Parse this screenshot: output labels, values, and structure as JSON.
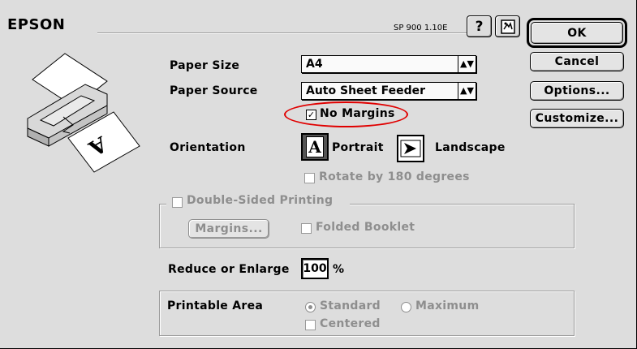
{
  "header": {
    "brand": "EPSON",
    "version": "SP 900 1.10E",
    "help_icon": "?",
    "help_icon_name": "help-icon",
    "utility_icon_name": "printer-utility-icon"
  },
  "buttons": {
    "ok": "OK",
    "cancel": "Cancel",
    "options": "Options...",
    "customize": "Customize..."
  },
  "paper_size": {
    "label": "Paper Size",
    "value": "A4"
  },
  "paper_source": {
    "label": "Paper Source",
    "value": "Auto Sheet Feeder"
  },
  "no_margins": {
    "label": "No Margins",
    "checked": true,
    "highlight_color": "#e00000"
  },
  "orientation": {
    "label": "Orientation",
    "portrait": "Portrait",
    "landscape": "Landscape",
    "selected": "Portrait"
  },
  "rotate_180": {
    "label": "Rotate by 180 degrees",
    "checked": false
  },
  "double_sided": {
    "label": "Double-Sided Printing",
    "checked": false,
    "margins_button": "Margins...",
    "folded_booklet": "Folded Booklet"
  },
  "reduce_enlarge": {
    "label": "Reduce or Enlarge",
    "value": "100",
    "unit": "%"
  },
  "printable_area": {
    "label": "Printable Area",
    "standard": "Standard",
    "maximum": "Maximum",
    "selected": "Standard",
    "centered": "Centered"
  }
}
